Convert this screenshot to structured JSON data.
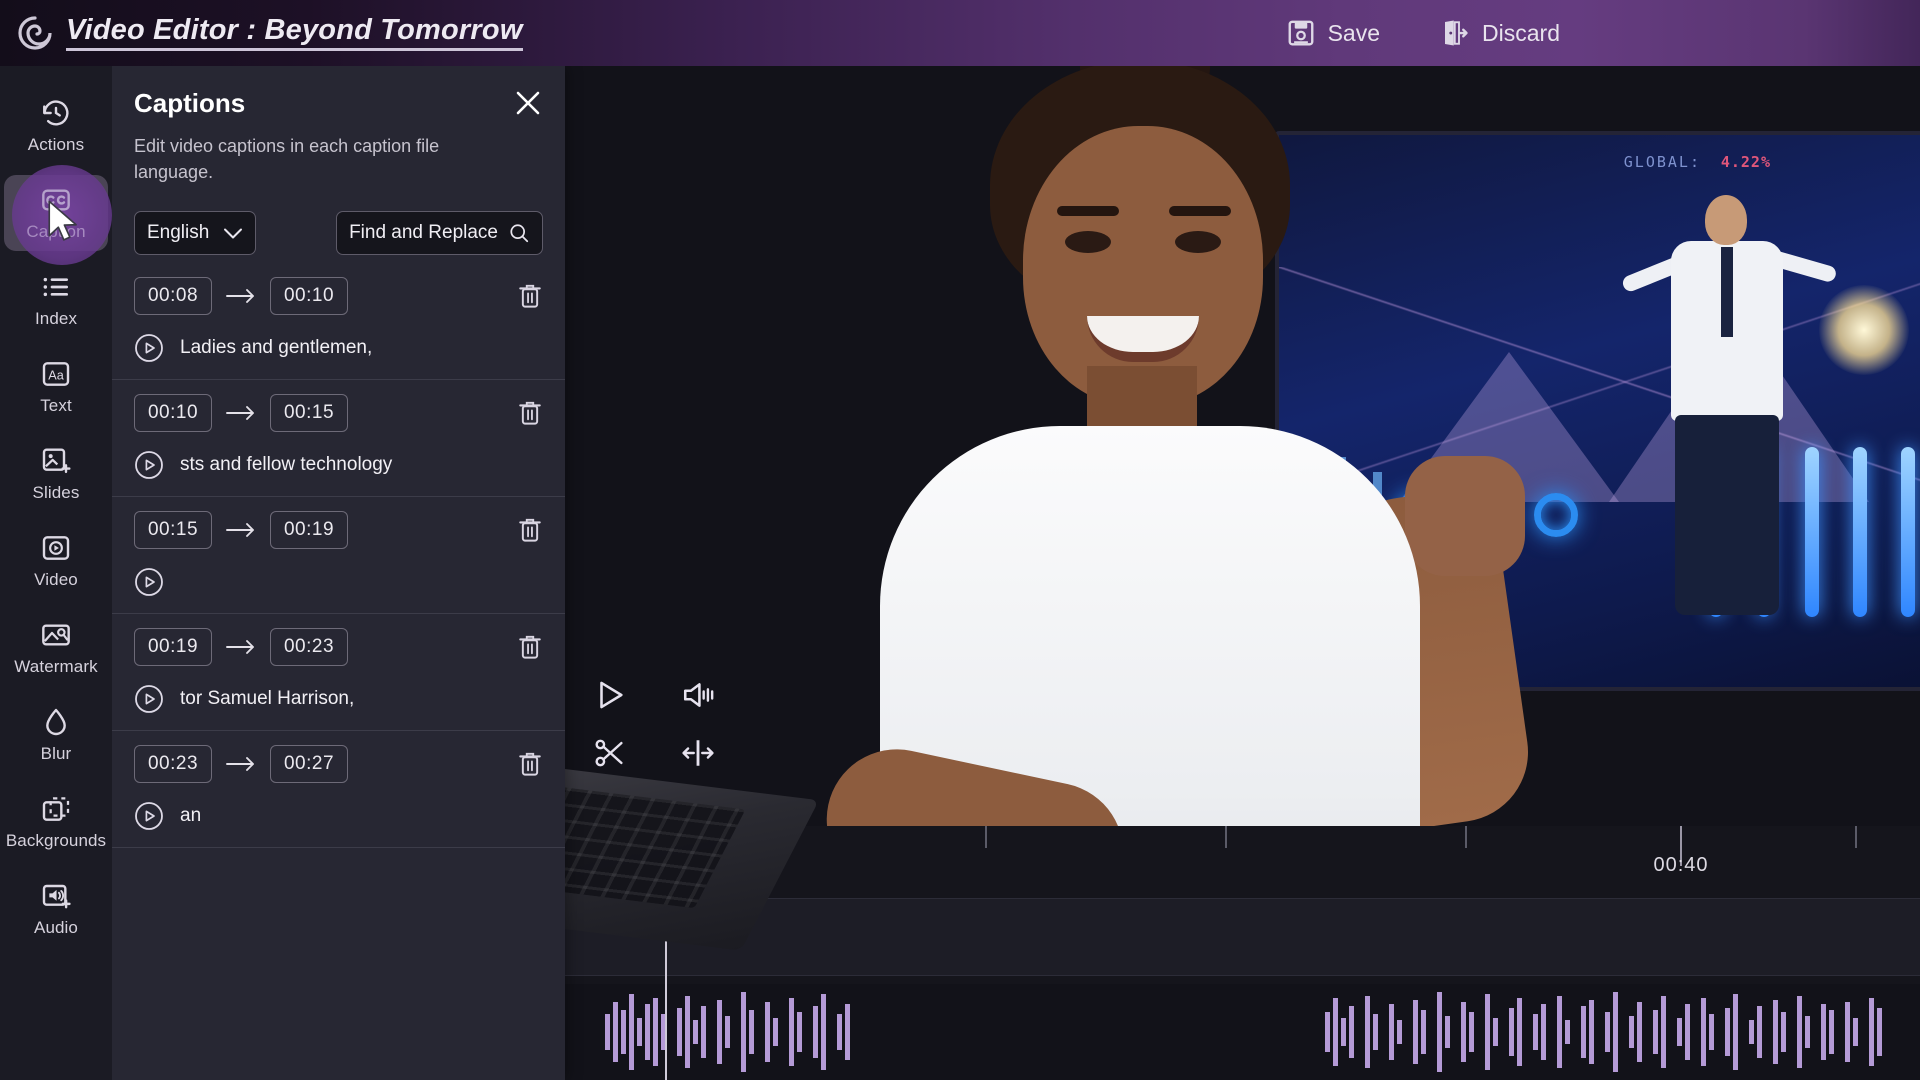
{
  "header": {
    "logo_icon": "swirl-logo-icon",
    "title": "Video Editor : Beyond Tomorrow",
    "save_label": "Save",
    "save_icon": "floppy-disk-icon",
    "discard_label": "Discard",
    "discard_icon": "exit-door-icon"
  },
  "sidebar": {
    "items": [
      {
        "label": "Actions",
        "icon": "history-clock-icon",
        "active": false
      },
      {
        "label": "Caption",
        "icon": "closed-caption-icon",
        "active": true
      },
      {
        "label": "Index",
        "icon": "list-icon",
        "active": false
      },
      {
        "label": "Text",
        "icon": "text-aa-icon",
        "active": false
      },
      {
        "label": "Slides",
        "icon": "image-plus-icon",
        "active": false
      },
      {
        "label": "Video",
        "icon": "video-play-icon",
        "active": false
      },
      {
        "label": "Watermark",
        "icon": "watermark-image-icon",
        "active": false
      },
      {
        "label": "Blur",
        "icon": "water-drop-icon",
        "active": false
      },
      {
        "label": "Backgrounds",
        "icon": "dashed-square-icon",
        "active": false
      },
      {
        "label": "Audio",
        "icon": "speaker-plus-icon",
        "active": false
      }
    ],
    "active_accent_color": "#6a3a90"
  },
  "captions_panel": {
    "title": "Captions",
    "description": "Edit video captions in each caption file language.",
    "close_icon": "close-x-icon",
    "language_value": "English",
    "language_chevron_icon": "chevron-down-icon",
    "find_replace_label": "Find and Replace",
    "find_replace_icon": "search-icon",
    "delete_icon": "trash-icon",
    "play_icon": "play-circle-icon",
    "arrow_icon": "arrow-right-icon",
    "rows": [
      {
        "start": "00:08",
        "end": "00:10",
        "text": "Ladies and gentlemen,"
      },
      {
        "start": "00:10",
        "end": "00:15",
        "text": "sts and fellow technology"
      },
      {
        "start": "00:15",
        "end": "00:19",
        "text": ""
      },
      {
        "start": "00:19",
        "end": "00:23",
        "text": "tor Samuel Harrison,"
      },
      {
        "start": "00:23",
        "end": "00:27",
        "text": "an"
      }
    ]
  },
  "player": {
    "controls": [
      {
        "label": "Play",
        "icon": "play-icon"
      },
      {
        "label": "Volume",
        "icon": "volume-icon"
      },
      {
        "label": "Split",
        "icon": "scissors-icon"
      },
      {
        "label": "Trim",
        "icon": "trim-resize-icon"
      }
    ]
  },
  "preview": {
    "overlay_stat_label": "GLOBAL:",
    "overlay_stat_value": "4.22%"
  },
  "timeline": {
    "time_marker": "00:40",
    "waveform_color": "#b49ad6"
  }
}
